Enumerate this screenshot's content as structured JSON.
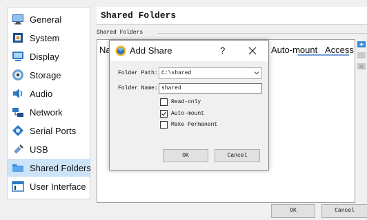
{
  "sidebar": {
    "items": [
      {
        "label": "General",
        "icon": "general-monitor-icon"
      },
      {
        "label": "System",
        "icon": "system-chip-icon"
      },
      {
        "label": "Display",
        "icon": "display-monitor-icon"
      },
      {
        "label": "Storage",
        "icon": "storage-disk-icon"
      },
      {
        "label": "Audio",
        "icon": "audio-speaker-icon"
      },
      {
        "label": "Network",
        "icon": "network-icon"
      },
      {
        "label": "Serial Ports",
        "icon": "serial-ports-icon"
      },
      {
        "label": "USB",
        "icon": "usb-icon"
      },
      {
        "label": "Shared Folders",
        "icon": "shared-folder-icon"
      },
      {
        "label": "User Interface",
        "icon": "user-interface-icon"
      }
    ],
    "selected": "Shared Folders"
  },
  "page": {
    "title": "Shared Folders",
    "group_label": "Shared Folders",
    "columns": [
      "Na",
      "Auto-mount",
      "Access"
    ]
  },
  "dialog": {
    "title": "Add Share",
    "help": "?",
    "folder_path_label": "Folder Path:",
    "folder_path_value": "C:\\shared",
    "folder_name_label": "Folder Name:",
    "folder_name_value": "shared",
    "read_only_label": "Read-only",
    "read_only_checked": false,
    "auto_mount_label": "Auto-mount",
    "auto_mount_checked": true,
    "make_permanent_label": "Make Permanent",
    "make_permanent_checked": false,
    "ok_label": "OK",
    "cancel_label": "Cancel"
  },
  "footer": {
    "ok_label": "OK",
    "cancel_label": "Cancel"
  },
  "colors": {
    "selected_bg": "#cde3f7",
    "accent_blue": "#1f63b8"
  }
}
